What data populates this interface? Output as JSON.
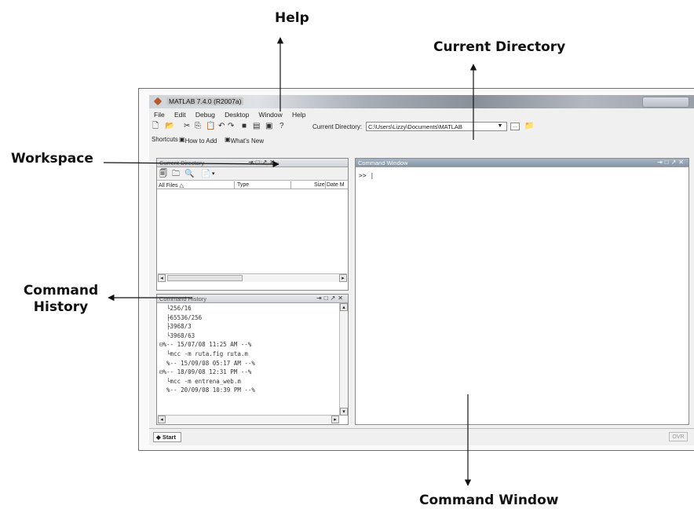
{
  "annotations": {
    "help": "Help",
    "current_directory": "Current Directory",
    "workspace": "Workspace",
    "command_history_line1": "Command",
    "command_history_line2": "History",
    "command_window": "Command Window"
  },
  "window": {
    "title": "MATLAB 7.4.0 (R2007a)"
  },
  "menu": [
    "File",
    "Edit",
    "Debug",
    "Desktop",
    "Window",
    "Help"
  ],
  "toolbar": {
    "current_directory_label": "Current Directory:",
    "current_directory_value": "C:\\Users\\Lizzy\\Documents\\MATLAB",
    "browse_label": "..."
  },
  "shortcuts": {
    "label": "Shortcuts",
    "how_to_add": "How to Add",
    "whats_new": "What's New"
  },
  "current_directory_panel": {
    "title": "Current Directory",
    "workspace_tab": "Workspace",
    "columns": [
      "All Files △",
      "Type",
      "Size",
      "Date M"
    ]
  },
  "command_window": {
    "title": "Command Window",
    "prompt": ">>"
  },
  "command_history": {
    "title": "Command History",
    "lines": [
      "  └256/16",
      "  ├65536/256",
      "  ├3968/3",
      "  └3968/63",
      "⊟%-- 15/07/08 11:25 AM --%",
      "  └mcc -m ruta.fig ruta.m",
      "  %-- 15/09/08 05:17 AM --%",
      "⊟%-- 18/09/08 12:31 PM --%",
      "  └mcc -m entrena_web.m",
      "  %-- 20/09/08 10:39 PM --%"
    ]
  },
  "statusbar": {
    "start": "Start",
    "ovr": "OVR"
  }
}
